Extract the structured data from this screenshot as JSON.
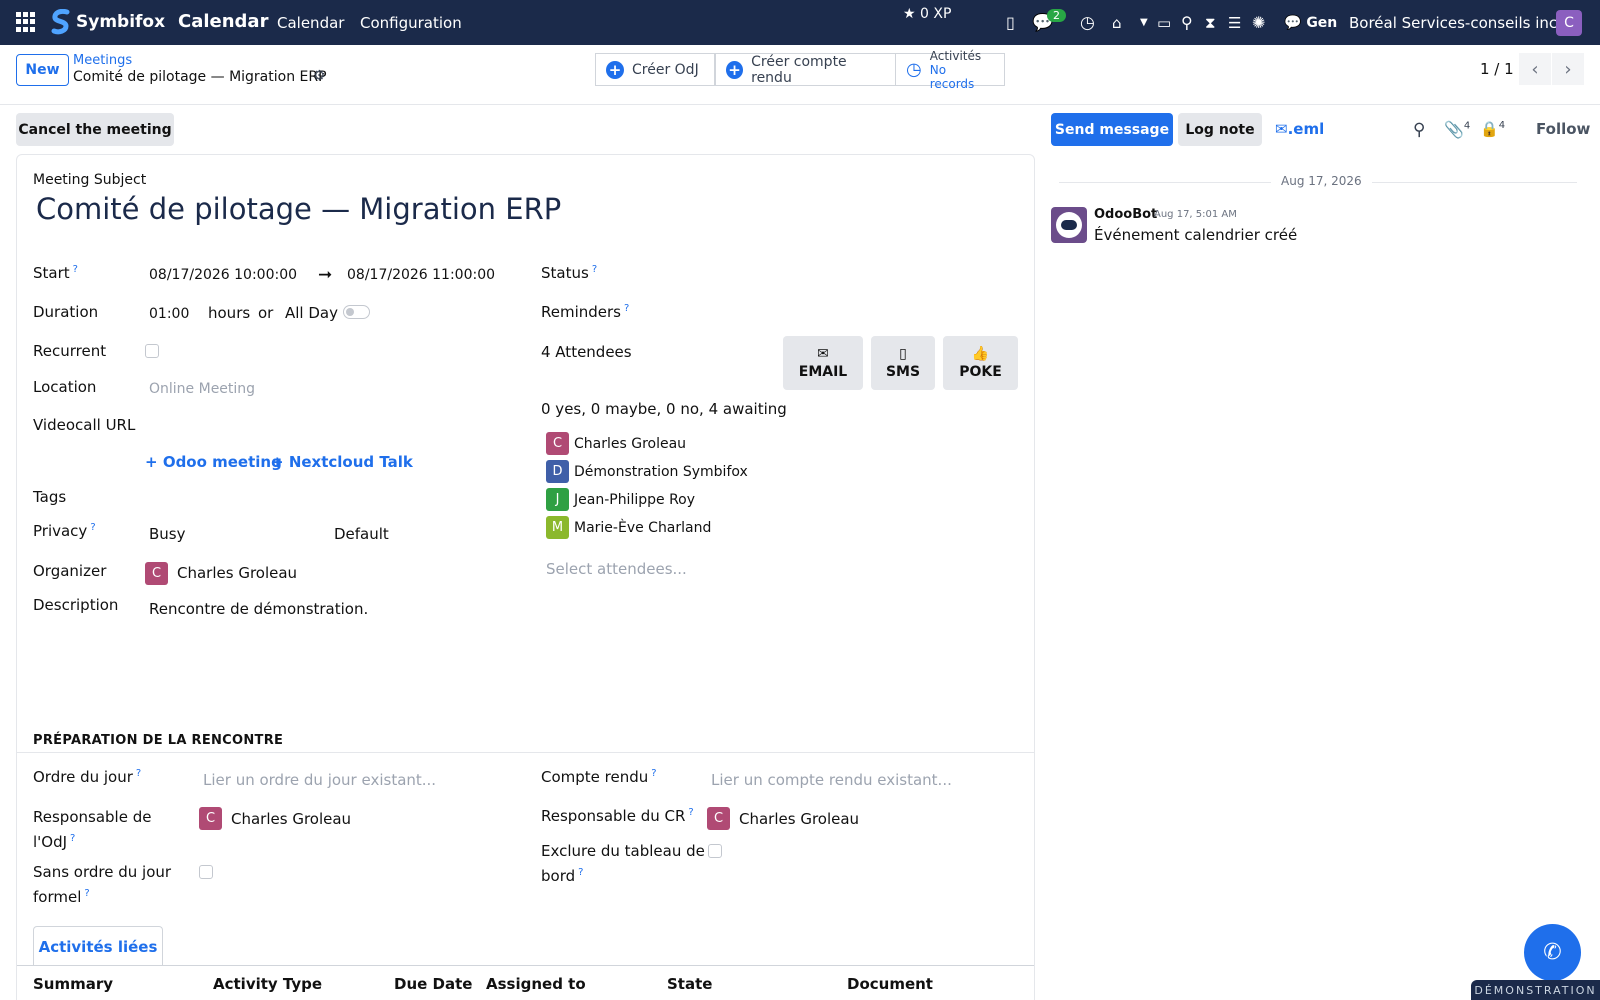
{
  "nav": {
    "brand": "Symbifox",
    "app": "Calendar",
    "menu": [
      "Calendar",
      "Configuration"
    ],
    "xp": "0 XP",
    "chat_count": "2",
    "gen_label": "Gen",
    "company": "Boréal Services-conseils inc.",
    "user_initial": "C"
  },
  "control": {
    "new_label": "New",
    "breadcrumb_parent": "Meetings",
    "breadcrumb_current": "Comité de pilotage — Migration ERP",
    "smart_buttons": {
      "create_odj": "Créer OdJ",
      "create_cr": "Créer compte rendu",
      "activities_title": "Activités",
      "activities_sub": "No records"
    },
    "pager": "1 / 1"
  },
  "actions": {
    "cancel_meeting": "Cancel the meeting"
  },
  "form": {
    "subject_label": "Meeting Subject",
    "subject": "Comité de pilotage — Migration ERP",
    "start_label": "Start",
    "start": "08/17/2026 10:00:00",
    "end": "08/17/2026 11:00:00",
    "duration_label": "Duration",
    "duration": "01:00",
    "hours": "hours",
    "or": "or",
    "all_day": "All Day",
    "recurrent_label": "Recurrent",
    "location_label": "Location",
    "location_placeholder": "Online Meeting",
    "videocall_label": "Videocall URL",
    "odoo_meeting": "Odoo meeting",
    "nextcloud": "Nextcloud Talk",
    "tags_label": "Tags",
    "privacy_label": "Privacy",
    "privacy_show_as": "Busy",
    "privacy_value": "Default",
    "organizer_label": "Organizer",
    "organizer": "Charles Groleau",
    "description_label": "Description",
    "description": "Rencontre de démonstration.",
    "status_label": "Status",
    "reminders_label": "Reminders",
    "attendees_count": "4 Attendees",
    "attendee_buttons": [
      "EMAIL",
      "SMS",
      "POKE"
    ],
    "attendee_summary": "0 yes, 0 maybe, 0 no, 4 awaiting",
    "attendees": [
      {
        "initial": "C",
        "name": "Charles Groleau",
        "color": "#b04a74"
      },
      {
        "initial": "D",
        "name": "Démonstration Symbifox",
        "color": "#3f5fa8"
      },
      {
        "initial": "J",
        "name": "Jean-Philippe Roy",
        "color": "#2fa043"
      },
      {
        "initial": "M",
        "name": "Marie-Ève Charland",
        "color": "#8bb82c"
      }
    ],
    "select_attendees_placeholder": "Select attendees..."
  },
  "prep": {
    "title": "PRÉPARATION DE LA RENCONTRE",
    "odj_label": "Ordre du jour",
    "odj_placeholder": "Lier un ordre du jour existant...",
    "cr_label": "Compte rendu",
    "cr_placeholder": "Lier un compte rendu existant...",
    "resp_odj_label_1": "Responsable de",
    "resp_odj_label_2": "l'OdJ",
    "resp_odj": "Charles Groleau",
    "resp_cr_label": "Responsable du CR",
    "resp_cr": "Charles Groleau",
    "sans_odj_label_1": "Sans ordre du jour",
    "sans_odj_label_2": "formel",
    "exclure_label_1": "Exclure du tableau de",
    "exclure_label_2": "bord"
  },
  "tabs": {
    "linked_activities": "Activités liées"
  },
  "table": {
    "headers": [
      "Summary",
      "Activity Type",
      "Due Date",
      "Assigned to",
      "State",
      "Document"
    ]
  },
  "chatter": {
    "send_message": "Send message",
    "log_note": "Log note",
    "eml": ".eml",
    "attachments_count": "4",
    "followers_count": "4",
    "follow": "Follow",
    "date": "Aug 17, 2026",
    "messages": [
      {
        "author": "OdooBot",
        "time": "Aug 17, 5:01 AM",
        "body": "Événement calendrier créé"
      }
    ]
  },
  "footer": {
    "demo_label": "DÉMONSTRATION"
  },
  "colors": {
    "navbar": "#1b2a4a",
    "primary": "#1f6feb",
    "organizer_avatar": "#b04a74"
  }
}
